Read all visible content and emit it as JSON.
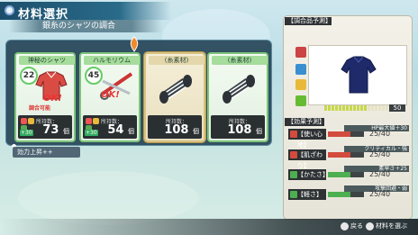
{
  "header": {
    "title": "材料選択",
    "subtitle": "銀糸のシャツの調合"
  },
  "cards": [
    {
      "name": "神秘のシャツ",
      "level": "22",
      "count_label": "所持数：",
      "count": "73",
      "unit": "個",
      "ok": "OK!",
      "mix_ok": "調合可能",
      "plus": "+30"
    },
    {
      "name": "ハルモリウム",
      "level": "45",
      "count_label": "所持数：",
      "count": "54",
      "unit": "個",
      "ok": "OK!",
      "plus": "+30"
    },
    {
      "name": "(糸素材)",
      "count_label": "所持数：",
      "count": "108",
      "unit": "個"
    },
    {
      "name": "(糸素材)",
      "count_label": "所持数：",
      "count": "108",
      "unit": "個"
    }
  ],
  "effect_bar": {
    "text": "効力上昇++"
  },
  "preview": {
    "header": "【調合品予測】",
    "level": "50"
  },
  "effects": {
    "header": "【効果予測】",
    "rows": [
      {
        "head": "HP最大値＋30",
        "name": "【使い心地】",
        "value": "25/40",
        "fill": 0.62,
        "color": "#d24b3c"
      },
      {
        "head": "クリティカル・強",
        "name": "【肌ざわり】",
        "value": "25/40",
        "fill": 0.62,
        "color": "#d24b3c"
      },
      {
        "head": "素早さ＋25",
        "name": "【かたさ】",
        "value": "25/40",
        "fill": 0.62,
        "color": "#4caf50"
      },
      {
        "head": "攻撃回避・弱",
        "name": "【軽さ】",
        "value": "25/40",
        "fill": 0.62,
        "color": "#4caf50"
      }
    ]
  },
  "footer": {
    "back": "戻る",
    "select": "材料を選ぶ"
  }
}
